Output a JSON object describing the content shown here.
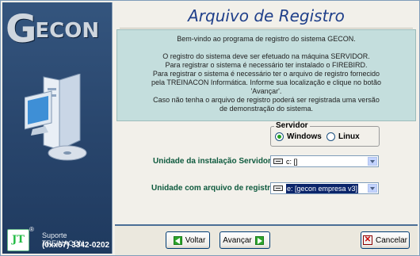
{
  "sidebar": {
    "logo_text_big": "G",
    "logo_text_rest": "ECON",
    "support_badge": "JT",
    "registered_mark": "®",
    "support_label": "Suporte TREINACON",
    "support_phone": "(0xx67) 3342-0202"
  },
  "header": {
    "title": "Arquivo de Registro"
  },
  "info": {
    "line1": "Bem-vindo ao programa de registro do sistema GECON.",
    "line2": "O registro do sistema deve ser efetuado na máquina SERVIDOR.",
    "line3": "Para registrar o sistema é necessário ter instalado o  FIREBIRD.",
    "line4": "Para registrar o sistema é necessário ter o arquivo de registro fornecido",
    "line5": "pela TREINACON Informática. Informe sua localização e clique no botão",
    "line6": "'Avançar'.",
    "line7": "Caso não tenha o arquivo de registro poderá ser registrada uma versão",
    "line8": "de demonstração do sistema."
  },
  "server": {
    "caption": "Servidor",
    "options": [
      {
        "label": "Windows",
        "selected": true
      },
      {
        "label": "Linux",
        "selected": false
      }
    ]
  },
  "install_drive": {
    "label": "Unidade da instalação Servidor",
    "value": "c: []"
  },
  "registry_drive": {
    "label": "Unidade com arquivo de registro",
    "value": "e: [gecon empresa v3]"
  },
  "buttons": {
    "back": "Voltar",
    "next": "Avançar",
    "cancel": "Cancelar"
  },
  "colors": {
    "title": "#1f3f8a",
    "info_panel": "#c4dedd",
    "label": "#0e5a3e",
    "sidebar": "#29466d"
  }
}
